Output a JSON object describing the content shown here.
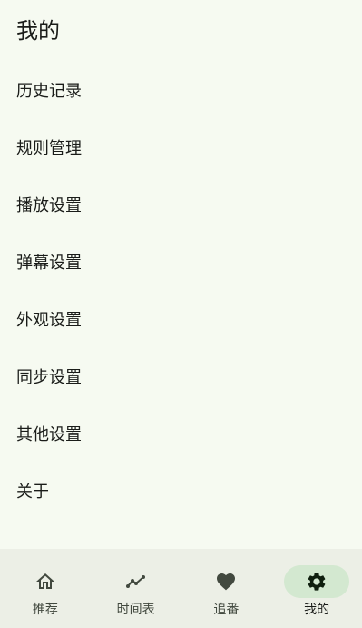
{
  "page": {
    "title": "我的"
  },
  "menu": {
    "items": [
      {
        "label": "历史记录"
      },
      {
        "label": "规则管理"
      },
      {
        "label": "播放设置"
      },
      {
        "label": "弹幕设置"
      },
      {
        "label": "外观设置"
      },
      {
        "label": "同步设置"
      },
      {
        "label": "其他设置"
      },
      {
        "label": "关于"
      }
    ]
  },
  "bottom_nav": {
    "items": [
      {
        "label": "推荐",
        "icon": "home-icon",
        "active": false
      },
      {
        "label": "时间表",
        "icon": "timeline-icon",
        "active": false
      },
      {
        "label": "追番",
        "icon": "heart-icon",
        "active": false
      },
      {
        "label": "我的",
        "icon": "gear-icon",
        "active": true
      }
    ]
  },
  "colors": {
    "background": "#f6faf1",
    "nav_background": "#ecefe6",
    "active_indicator": "#d3e8d0",
    "text_primary": "#1a1c19",
    "text_secondary": "#42493f"
  }
}
